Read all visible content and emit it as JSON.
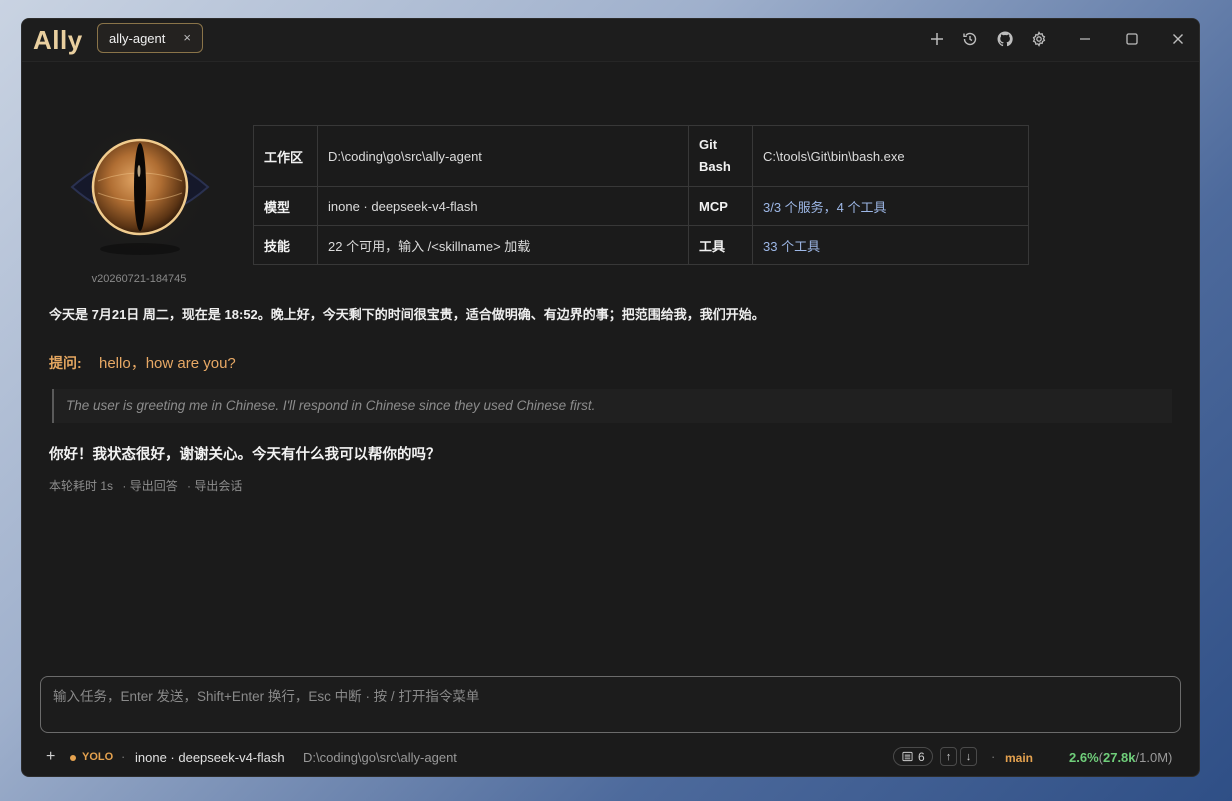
{
  "app": {
    "logo": "Ally",
    "tab_label": "ally-agent",
    "tab_close": "×",
    "version": "v20260721-184745"
  },
  "info": {
    "workspace_label": "工作区",
    "workspace_value": "D:\\coding\\go\\src\\ally-agent",
    "gitbash_label": "Git Bash",
    "gitbash_value": "C:\\tools\\Git\\bin\\bash.exe",
    "model_label": "模型",
    "model_value": "inone · deepseek-v4-flash",
    "mcp_label": "MCP",
    "mcp_value": "3/3 个服务，4 个工具",
    "skills_label": "技能",
    "skills_value": "22 个可用，输入 /<skillname> 加载",
    "tools_label": "工具",
    "tools_value": "33 个工具"
  },
  "chat": {
    "greeting": "今天是 7月21日 周二，现在是 18:52。晚上好，今天剩下的时间很宝贵，适合做明确、有边界的事；把范围给我，我们开始。",
    "question_label": "提问:",
    "question_text": "hello，how are you?",
    "thinking": "The user is greeting me in Chinese. I'll respond in Chinese since they used Chinese first.",
    "reply": "你好！我状态很好，谢谢关心。今天有什么我可以帮你的吗？",
    "meta_time": "本轮耗时 1s",
    "meta_export_answer": "· 导出回答",
    "meta_export_session": "· 导出会话"
  },
  "input": {
    "placeholder": "输入任务，Enter 发送，Shift+Enter 换行，Esc 中断 · 按 / 打开指令菜单"
  },
  "status": {
    "plus": "+",
    "mode": "YOLO",
    "sep": "·",
    "model": "inone · deepseek-v4-flash",
    "path": "D:\\coding\\go\\src\\ally-agent",
    "count": "6",
    "up": "↑",
    "down": "↓",
    "branch": "main",
    "usage_pct": "2.6%",
    "usage_open": "(",
    "usage_used": "27.8k",
    "usage_total": "/1.0M)"
  },
  "colors": {
    "accent": "#e5a24f",
    "link": "#9db7e6",
    "usage": "#6fce7a"
  },
  "icons": [
    "plus-icon",
    "history-icon",
    "github-icon",
    "settings-icon",
    "minimize-icon",
    "maximize-icon",
    "close-icon",
    "eye-logo-icon",
    "list-icon"
  ]
}
